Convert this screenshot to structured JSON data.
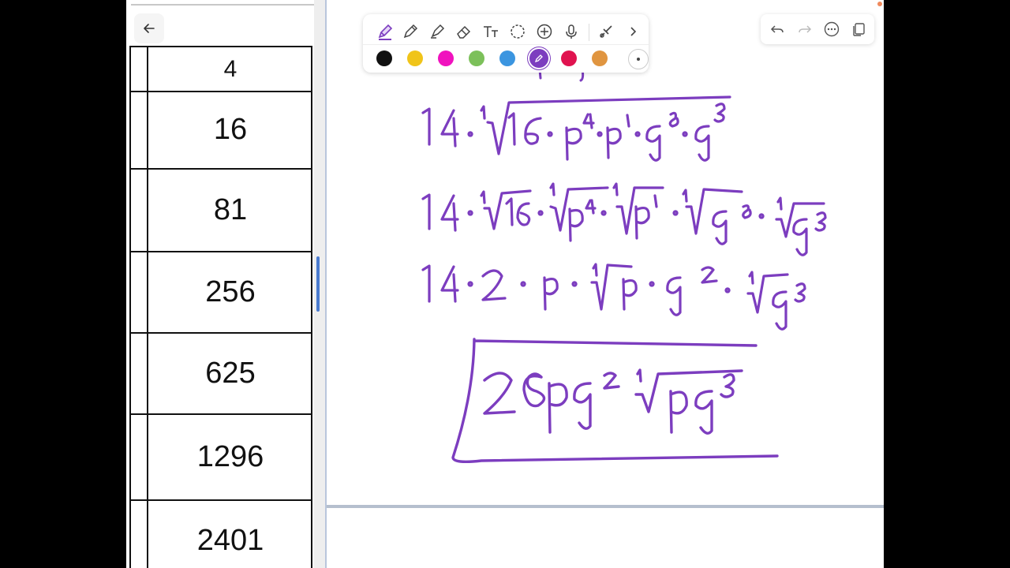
{
  "left_table": {
    "rows": [
      "4",
      "16",
      "81",
      "256",
      "625",
      "1296",
      "2401"
    ]
  },
  "toolbar": {
    "tools": [
      "pen-icon",
      "pencil-icon",
      "highlighter-icon",
      "eraser-icon",
      "text-icon",
      "lasso-icon",
      "add-icon",
      "microphone-icon",
      "more-tools-icon",
      "chevron-right-icon"
    ],
    "colors": [
      "#111111",
      "#f0c419",
      "#f012be",
      "#7cc05a",
      "#3b95e0",
      "#7c3dbf",
      "#e0134f",
      "#e09540"
    ],
    "selected_color": "#7c3dbf"
  },
  "right_toolbar": {
    "tools": [
      "undo-icon",
      "redo-icon",
      "more-icon",
      "pages-icon"
    ]
  },
  "handwriting": {
    "line1": "14·⁴√(16·p⁴·p¹·q⁸·q³)",
    "line2": "14·⁴√16·⁴√p⁴·⁴√p¹·⁴√q⁸·⁴√q³",
    "line3": "14·2·p·⁴√p·q²·⁴√q³",
    "answer": "28pq²⁴√(pq³)"
  }
}
